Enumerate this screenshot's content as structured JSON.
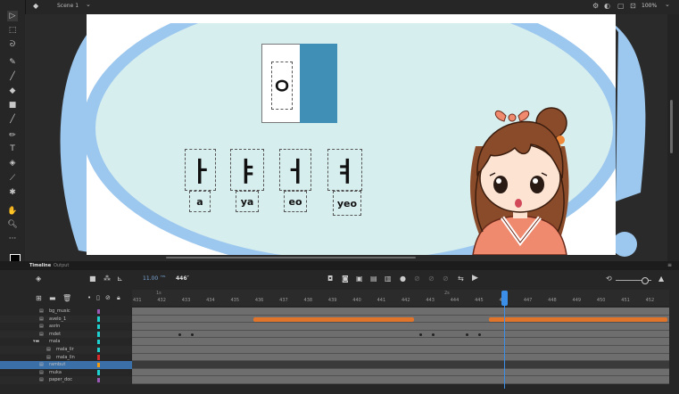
{
  "topbar": {
    "scene_label": "Scene 1",
    "zoom": "100%"
  },
  "stage": {
    "big_glyph": "ㅇ",
    "vowels": [
      {
        "jamo": "ㅏ",
        "roman": "a"
      },
      {
        "jamo": "ㅑ",
        "roman": "ya"
      },
      {
        "jamo": "ㅓ",
        "roman": "eo"
      },
      {
        "jamo": "ㅕ",
        "roman": "yeo"
      }
    ],
    "colors": {
      "bg": "#d7eeef",
      "blue": "#9cc7ee",
      "block": "#3f8fb7"
    }
  },
  "panel": {
    "tabs": {
      "timeline": "Timeline",
      "output": "Output"
    },
    "fps": "11.00",
    "fps_unit": "FPS",
    "current_frame": "446",
    "frame_marker_1s": "1s",
    "frame_marker_2s": "2s",
    "ruler_numbers": [
      "431",
      "432",
      "433",
      "434",
      "435",
      "436",
      "437",
      "438",
      "439",
      "440",
      "441",
      "442",
      "443",
      "444",
      "445",
      "446",
      "447",
      "448",
      "449",
      "450",
      "451",
      "452"
    ]
  },
  "layers": [
    {
      "name": "bg_music",
      "color": "#9b59b6",
      "type": "layer",
      "indent": 0
    },
    {
      "name": "avelo_1",
      "color": "#1fd0d0",
      "type": "layer",
      "indent": 0
    },
    {
      "name": "asrin",
      "color": "#1fd0d0",
      "type": "layer",
      "indent": 0
    },
    {
      "name": "mdet",
      "color": "#1fd0d0",
      "type": "layer",
      "indent": 0
    },
    {
      "name": "mala",
      "color": "#1fd0d0",
      "type": "folder",
      "indent": 0
    },
    {
      "name": "mala_lir",
      "color": "#1fd0d0",
      "type": "layer",
      "indent": 1
    },
    {
      "name": "mala_lin",
      "color": "#d62b2b",
      "type": "layer",
      "indent": 1
    },
    {
      "name": "rambut",
      "color": "#f39c12",
      "type": "layer",
      "indent": 0,
      "selected": true
    },
    {
      "name": "muka",
      "color": "#1fd0d0",
      "type": "layer",
      "indent": 0
    },
    {
      "name": "paper_doc",
      "color": "#9b59b6",
      "type": "layer",
      "indent": 0
    }
  ]
}
